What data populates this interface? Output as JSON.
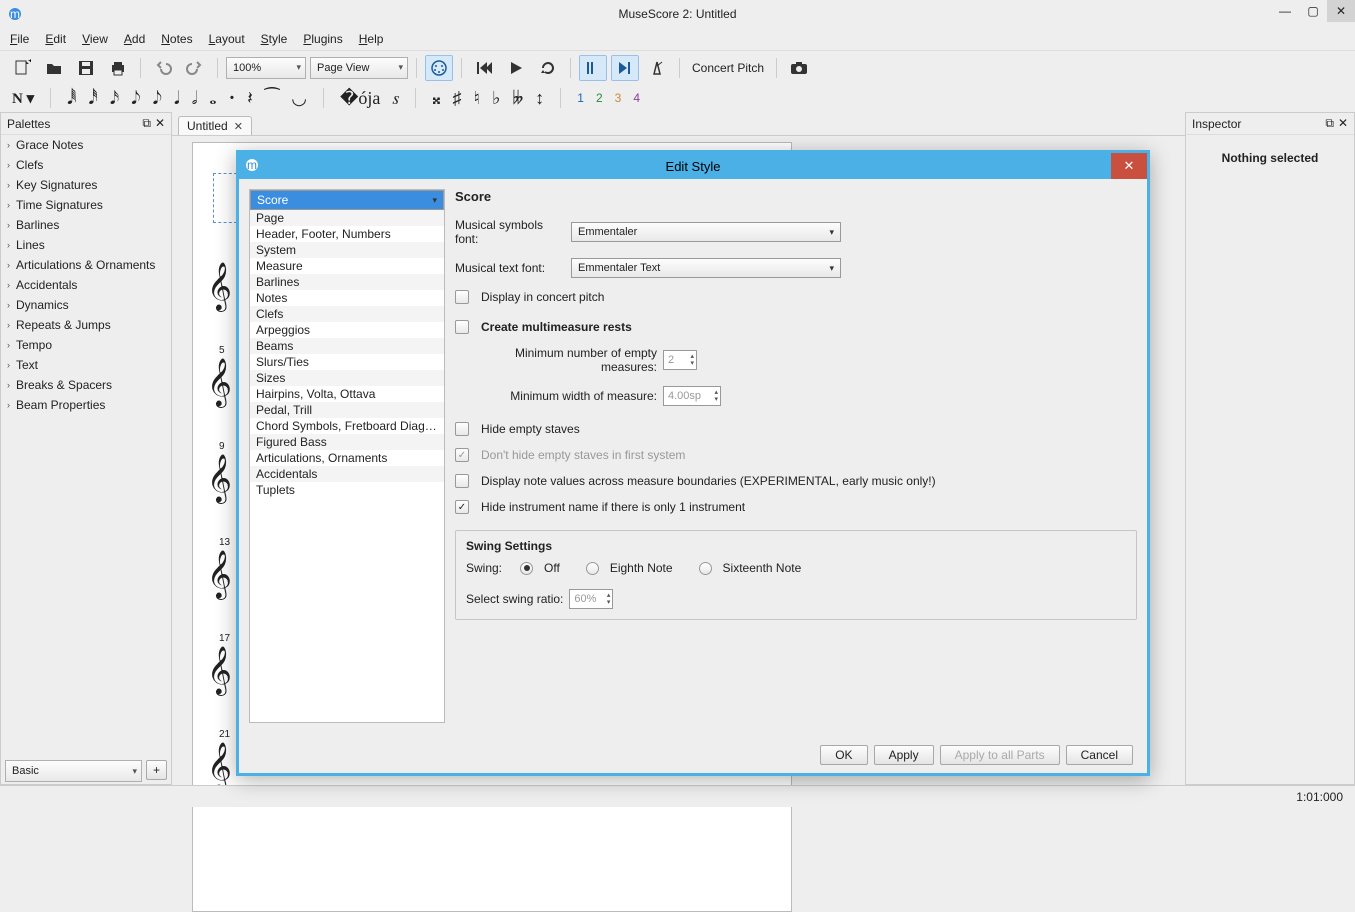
{
  "window": {
    "title": "MuseScore 2: Untitled"
  },
  "menu": [
    "File",
    "Edit",
    "View",
    "Add",
    "Notes",
    "Layout",
    "Style",
    "Plugins",
    "Help"
  ],
  "toolbar": {
    "zoom": "100%",
    "view": "Page View",
    "concertPitch": "Concert Pitch"
  },
  "voices": [
    "1",
    "2",
    "3",
    "4"
  ],
  "palettes": {
    "title": "Palettes",
    "items": [
      "Grace Notes",
      "Clefs",
      "Key Signatures",
      "Time Signatures",
      "Barlines",
      "Lines",
      "Articulations & Ornaments",
      "Accidentals",
      "Dynamics",
      "Repeats & Jumps",
      "Tempo",
      "Text",
      "Breaks & Spacers",
      "Beam Properties"
    ],
    "preset": "Basic"
  },
  "tab": {
    "name": "Untitled"
  },
  "scoreMeasureNumbers": [
    "5",
    "9",
    "13",
    "17",
    "21"
  ],
  "inspector": {
    "title": "Inspector",
    "content": "Nothing selected"
  },
  "status": {
    "time": "1:01:000"
  },
  "dialog": {
    "title": "Edit Style",
    "categories": [
      "Score",
      "Page",
      "Header, Footer, Numbers",
      "System",
      "Measure",
      "Barlines",
      "Notes",
      "Clefs",
      "Arpeggios",
      "Beams",
      "Slurs/Ties",
      "Sizes",
      "Hairpins, Volta, Ottava",
      "Pedal, Trill",
      "Chord Symbols, Fretboard Diagra…",
      "Figured Bass",
      "Articulations, Ornaments",
      "Accidentals",
      "Tuplets"
    ],
    "selected": "Score",
    "form": {
      "heading": "Score",
      "musicalSymbolsFontLabel": "Musical symbols font:",
      "musicalSymbolsFont": "Emmentaler",
      "musicalTextFontLabel": "Musical text font:",
      "musicalTextFont": "Emmentaler Text",
      "displayConcertPitch": "Display in concert pitch",
      "createMMR": "Create multimeasure rests",
      "minEmptyLabel": "Minimum number of empty measures:",
      "minEmpty": "2",
      "minWidthLabel": "Minimum width of measure:",
      "minWidth": "4.00sp",
      "hideEmpty": "Hide empty staves",
      "dontHideFirst": "Don't hide empty staves in first system",
      "displayNoteValues": "Display note values across measure boundaries (EXPERIMENTAL, early music only!)",
      "hideInstrName": "Hide instrument name if there is only 1 instrument",
      "swingHeading": "Swing Settings",
      "swingLabel": "Swing:",
      "swingOff": "Off",
      "swingEighth": "Eighth Note",
      "swingSixteenth": "Sixteenth Note",
      "selectSwingRatioLabel": "Select swing ratio:",
      "selectSwingRatio": "60%"
    },
    "buttons": {
      "ok": "OK",
      "apply": "Apply",
      "applyAll": "Apply to all Parts",
      "cancel": "Cancel"
    }
  }
}
